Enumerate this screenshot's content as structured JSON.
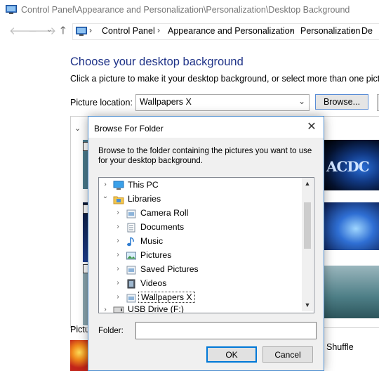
{
  "window": {
    "title": "Control Panel\\Appearance and Personalization\\Personalization\\Desktop Background"
  },
  "nav": {
    "back_icon": "back-arrow-icon",
    "forward_icon": "forward-arrow-icon",
    "recent_icon": "chevron-down-icon",
    "up_icon": "up-arrow-icon",
    "breadcrumbs": [
      "Control Panel",
      "Appearance and Personalization",
      "Personalization",
      "De"
    ]
  },
  "main": {
    "heading": "Choose your desktop background",
    "subtext": "Click a picture to make it your desktop background, or select more than one picture t",
    "picture_location_label": "Picture location:",
    "picture_location_value": "Wallpapers X",
    "browse_label": "Browse...",
    "picture_position_label": "Pictu",
    "shuffle_label": "Shuffle"
  },
  "dialog": {
    "title": "Browse For Folder",
    "close_icon": "close-icon",
    "description": "Browse to the folder containing the pictures you want to use for your desktop background.",
    "tree": [
      {
        "label": "This PC",
        "icon": "computer-icon",
        "expander": "›"
      },
      {
        "label": "Libraries",
        "icon": "libraries-folder-icon",
        "expander": "⌄"
      },
      {
        "label": "Camera Roll",
        "icon": "library-icon",
        "expander": "›"
      },
      {
        "label": "Documents",
        "icon": "documents-icon",
        "expander": "›"
      },
      {
        "label": "Music",
        "icon": "music-icon",
        "expander": "›"
      },
      {
        "label": "Pictures",
        "icon": "pictures-icon",
        "expander": "›"
      },
      {
        "label": "Saved Pictures",
        "icon": "library-icon",
        "expander": "›"
      },
      {
        "label": "Videos",
        "icon": "videos-icon",
        "expander": "›"
      },
      {
        "label": "Wallpapers X",
        "icon": "library-icon",
        "expander": "›"
      },
      {
        "label": "USB Drive (F:)",
        "icon": "usb-drive-icon",
        "expander": "›"
      }
    ],
    "folder_label": "Folder:",
    "folder_value": "",
    "ok_label": "OK",
    "cancel_label": "Cancel"
  },
  "colors": {
    "heading": "#1e3287",
    "dialog_border": "#4f8fd0",
    "accent": "#0078d7"
  }
}
